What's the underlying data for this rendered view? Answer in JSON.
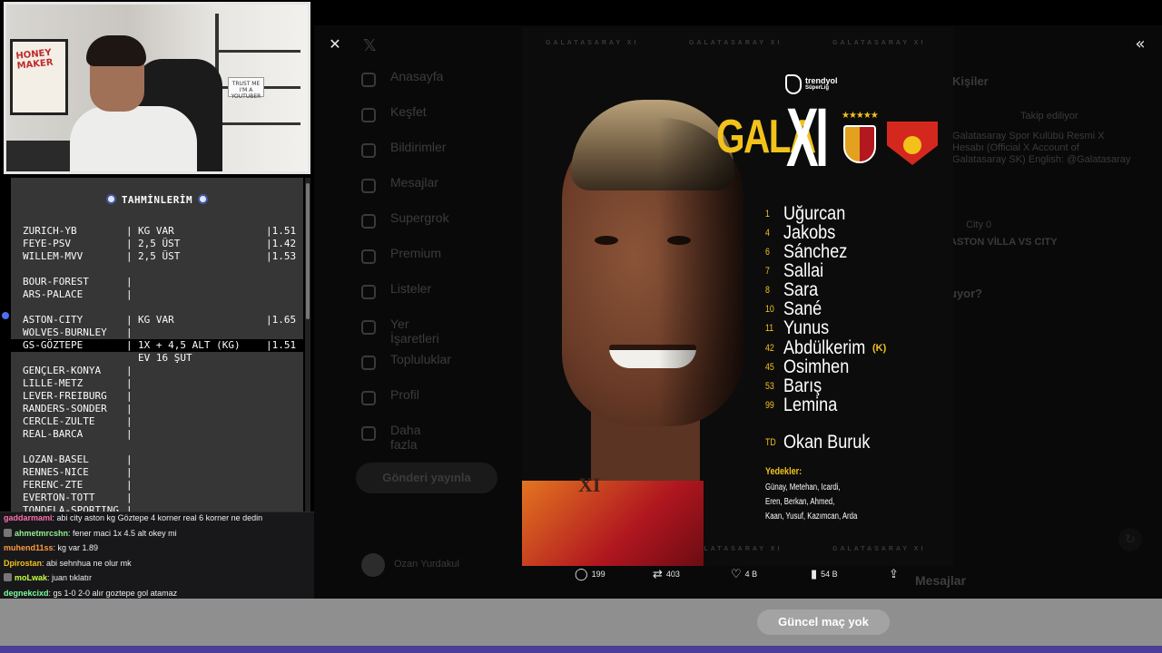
{
  "predictions": {
    "title": "TAHMİNLERİM",
    "rows": [
      {
        "match": "ZURICH-YB",
        "sep": "|",
        "pick": "KG VAR",
        "odds": "|1.51"
      },
      {
        "match": "FEYE-PSV",
        "sep": "|",
        "pick": "2,5 ÜST",
        "odds": "|1.42"
      },
      {
        "match": "WILLEM-MVV",
        "sep": "|",
        "pick": "2,5 ÜST",
        "odds": "|1.53"
      },
      {
        "match": "BOUR-FOREST",
        "sep": "|",
        "pick": "",
        "odds": ""
      },
      {
        "match": "ARS-PALACE",
        "sep": "|",
        "pick": "",
        "odds": ""
      },
      {
        "match": "ASTON-CITY",
        "sep": "|",
        "pick": "KG VAR",
        "odds": "|1.65"
      },
      {
        "match": "WOLVES-BURNLEY",
        "sep": "|",
        "pick": "",
        "odds": ""
      },
      {
        "match": "GS-GÖZTEPE",
        "sep": "|",
        "pick": "1X + 4,5 ALT (KG)",
        "odds": "|1.51"
      },
      {
        "match": "",
        "sep": "",
        "pick": "EV 16 ŞUT",
        "odds": ""
      },
      {
        "match": "GENÇLER-KONYA",
        "sep": "|",
        "pick": "",
        "odds": ""
      },
      {
        "match": "LILLE-METZ",
        "sep": "|",
        "pick": "",
        "odds": ""
      },
      {
        "match": "LEVER-FREIBURG",
        "sep": "|",
        "pick": "",
        "odds": ""
      },
      {
        "match": "RANDERS-SONDER",
        "sep": "|",
        "pick": "",
        "odds": ""
      },
      {
        "match": "CERCLE-ZULTE",
        "sep": "|",
        "pick": "",
        "odds": ""
      },
      {
        "match": "REAL-BARCA",
        "sep": "|",
        "pick": "",
        "odds": ""
      },
      {
        "match": "LOZAN-BASEL",
        "sep": "|",
        "pick": "",
        "odds": ""
      },
      {
        "match": "RENNES-NICE",
        "sep": "|",
        "pick": "",
        "odds": ""
      },
      {
        "match": "FERENC-ZTE",
        "sep": "|",
        "pick": "",
        "odds": ""
      },
      {
        "match": "EVERTON-TOTT",
        "sep": "|",
        "pick": "",
        "odds": ""
      },
      {
        "match": "TONDELA-SPORTING",
        "sep": "|",
        "pick": "",
        "odds": ""
      }
    ]
  },
  "chat": [
    {
      "user": "gaddarmami",
      "color": "#ff6fae",
      "badge": false,
      "text": ": abi city aston kg Göztepe 4 korner real 6 korner ne dedin"
    },
    {
      "user": "ahmetmrcshn",
      "color": "#8ff08f",
      "badge": true,
      "text": ": fener maci 1x 4.5 alt okey mi"
    },
    {
      "user": "muhend11ss",
      "color": "#ff9a3c",
      "badge": false,
      "text": ": kg var 1.89"
    },
    {
      "user": "Dpirostan",
      "color": "#f2c21b",
      "badge": false,
      "text": ": abi sehnhua ne olur mk"
    },
    {
      "user": "moLwak",
      "color": "#c7ff4a",
      "badge": true,
      "text": ": juan tıklatır"
    },
    {
      "user": "degnekcixd",
      "color": "#7dff9c",
      "badge": false,
      "text": ": gs 1-0 2-0 alır goztepe gol atamaz"
    }
  ],
  "webcam": {
    "poster_text": "HONEY MAKER",
    "sign_text": "TRUST ME I'M A YOUTUBER"
  },
  "x_nav": [
    "Anasayfa",
    "Keşfet",
    "Bildirimler",
    "Mesajlar",
    "Supergrok",
    "Premium",
    "Listeler",
    "Yer İşaretleri",
    "Topluluklar",
    "Profil",
    "Daha fazla"
  ],
  "x_nav_icons": [
    "home-icon",
    "search-icon",
    "bell-icon",
    "mail-icon",
    "grok-icon",
    "x-premium-icon",
    "list-icon",
    "bookmark-icon",
    "community-icon",
    "profile-icon",
    "more-icon"
  ],
  "x_post_button": "Gönderi yayınla",
  "x_user_name": "Ozan Yurdakul",
  "x_messages": "Mesajlar",
  "x_right": {
    "heading": "Kişiler",
    "follow": "Takip ediliyor",
    "bio1": "Galatasaray Spor Kulübü Resmi X",
    "bio2": "Hesabı (Official X Account of",
    "bio3": "Galatasaray SK) English: @Galatasaray",
    "trend": "City 0",
    "trend2": "ASTON VİLLA VS CITY",
    "whats": "uyor?"
  },
  "lineup": {
    "watermark": "GALATASARAY XI",
    "league_1": "trendyol",
    "league_2": "SüperLig",
    "gala": "GALA",
    "xi": "XI",
    "tattoo": "XI",
    "players": [
      {
        "num": "1",
        "name": "Uğurcan",
        "cap": ""
      },
      {
        "num": "4",
        "name": "Jakobs",
        "cap": ""
      },
      {
        "num": "6",
        "name": "Sánchez",
        "cap": ""
      },
      {
        "num": "7",
        "name": "Sallai",
        "cap": ""
      },
      {
        "num": "8",
        "name": "Sara",
        "cap": ""
      },
      {
        "num": "10",
        "name": "Sané",
        "cap": ""
      },
      {
        "num": "11",
        "name": "Yunus",
        "cap": ""
      },
      {
        "num": "42",
        "name": "Abdülkerim",
        "cap": "(K)"
      },
      {
        "num": "45",
        "name": "Osimhen",
        "cap": ""
      },
      {
        "num": "53",
        "name": "Barış",
        "cap": ""
      },
      {
        "num": "99",
        "name": "Lemina",
        "cap": ""
      }
    ],
    "coach": {
      "num": "TD",
      "name": "Okan Buruk"
    },
    "subs_title": "Yedekler:",
    "subs": [
      "Günay, Metehan, Icardi,",
      "Eren, Berkan, Ahmed,",
      "Kaan, Yusuf, Kazımcan, Arda"
    ]
  },
  "post_actions": {
    "replies": "199",
    "reposts": "403",
    "likes": "4 B",
    "views": "54 B"
  },
  "bottom": {
    "no_match": "Güncel maç yok"
  },
  "colors": {
    "gold": "#f2c21b",
    "bar": "#8f8f8f",
    "purple": "#4b3e98"
  }
}
